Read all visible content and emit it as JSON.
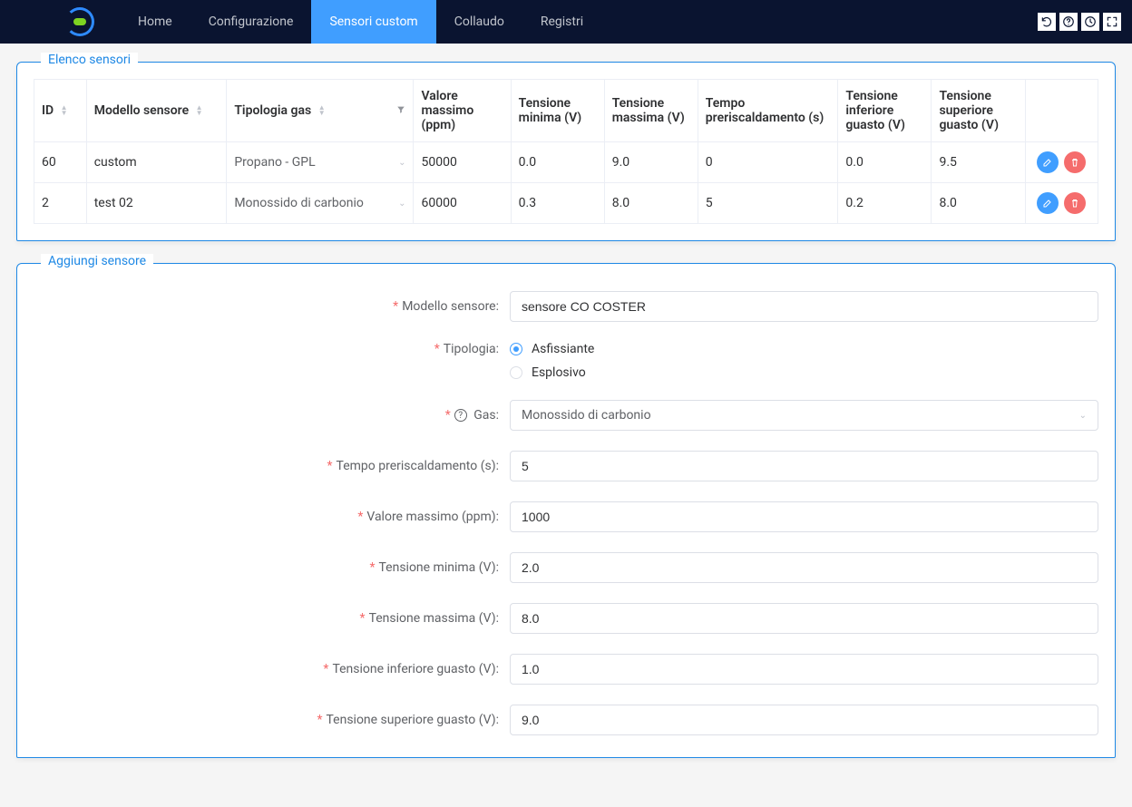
{
  "nav": {
    "items": [
      {
        "label": "Home"
      },
      {
        "label": "Configurazione"
      },
      {
        "label": "Sensori custom",
        "active": true
      },
      {
        "label": "Collaudo"
      },
      {
        "label": "Registri"
      }
    ]
  },
  "panels": {
    "list_title": "Elenco sensori",
    "add_title": "Aggiungi sensore"
  },
  "table": {
    "headers": {
      "id": "ID",
      "model": "Modello sensore",
      "gas": "Tipologia gas",
      "vmax": "Valore massimo (ppm)",
      "tmin": "Tensione minima (V)",
      "tmax": "Tensione massima (V)",
      "preheat": "Tempo preriscaldamento (s)",
      "tlowfault": "Tensione inferiore guasto (V)",
      "thighfault": "Tensione superiore guasto (V)"
    },
    "rows": [
      {
        "id": "60",
        "model": "custom",
        "gas": "Propano - GPL",
        "vmax": "50000",
        "tmin": "0.0",
        "tmax": "9.0",
        "preheat": "0",
        "tlowfault": "0.0",
        "thighfault": "9.5"
      },
      {
        "id": "2",
        "model": "test 02",
        "gas": "Monossido di carbonio",
        "vmax": "60000",
        "tmin": "0.3",
        "tmax": "8.0",
        "preheat": "5",
        "tlowfault": "0.2",
        "thighfault": "8.0"
      }
    ]
  },
  "form": {
    "labels": {
      "model": "Modello sensore:",
      "type": "Tipologia:",
      "gas": "Gas:",
      "preheat": "Tempo preriscaldamento (s):",
      "vmax": "Valore massimo (ppm):",
      "tmin": "Tensione minima (V):",
      "tmax": "Tensione massima (V):",
      "tlowfault": "Tensione inferiore guasto (V):",
      "thighfault": "Tensione superiore guasto (V):"
    },
    "values": {
      "model": "sensore CO COSTER",
      "gas": "Monossido di carbonio",
      "preheat": "5",
      "vmax": "1000",
      "tmin": "2.0",
      "tmax": "8.0",
      "tlowfault": "1.0",
      "thighfault": "9.0"
    },
    "type_options": {
      "asf": "Asfissiante",
      "esp": "Esplosivo"
    },
    "type_selected": "asf",
    "help_glyph": "?"
  }
}
